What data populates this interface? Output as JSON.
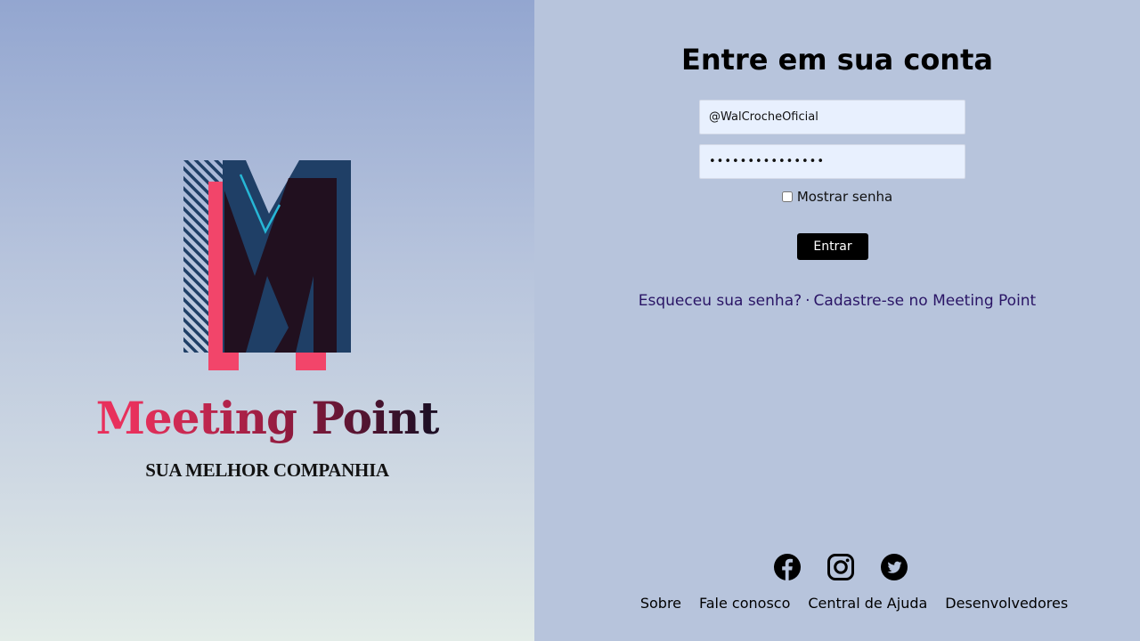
{
  "brand": {
    "name": "Meeting Point",
    "tagline": "SUA MELHOR COMPANHIA"
  },
  "login": {
    "title": "Entre em sua conta",
    "username_value": "@WalCrocheOficial",
    "password_value": "•••••••••••••••",
    "show_password_label": "Mostrar senha",
    "submit_label": "Entrar",
    "forgot_label": "Esqueceu sua senha?",
    "separator": "·",
    "signup_label": "Cadastre-se no Meeting Point"
  },
  "social": [
    {
      "icon": "facebook-icon"
    },
    {
      "icon": "instagram-icon"
    },
    {
      "icon": "twitter-icon"
    }
  ],
  "footer": {
    "about": "Sobre",
    "contact": "Fale conosco",
    "help": "Central de Ajuda",
    "developers": "Desenvolvedores"
  },
  "colors": {
    "login_bg": "#b7c4dc",
    "button_bg": "#000000",
    "link": "#2a1566",
    "logo_navy": "#1f3f66",
    "logo_pink": "#f2456a",
    "logo_dark": "#21101f"
  }
}
